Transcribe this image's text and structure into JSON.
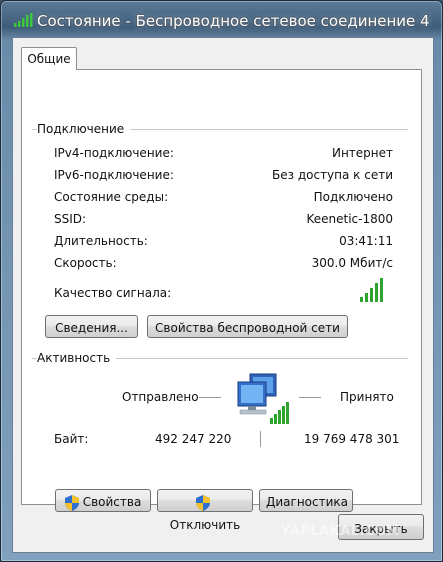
{
  "window": {
    "title": "Состояние - Беспроводное сетевое соединение 4"
  },
  "tabs": [
    {
      "label": "Общие"
    }
  ],
  "connection": {
    "section_title": "Подключение",
    "rows": [
      {
        "label": "IPv4-подключение:",
        "value": "Интернет"
      },
      {
        "label": "IPv6-подключение:",
        "value": "Без доступа к сети"
      },
      {
        "label": "Состояние среды:",
        "value": "Подключено"
      },
      {
        "label": "SSID:",
        "value": "Keenetic-1800"
      },
      {
        "label": "Длительность:",
        "value": "03:41:11"
      },
      {
        "label": "Скорость:",
        "value": "300.0 Мбит/с"
      }
    ],
    "signal_label": "Качество сигнала:",
    "signal_bars": 5
  },
  "buttons": {
    "details": "Сведения...",
    "wireless_props": "Свойства беспроводной сети",
    "properties": "Свойства",
    "disable": "Отключить",
    "diagnose": "Диагностика",
    "close": "Закрыть"
  },
  "activity": {
    "section_title": "Активность",
    "sent_label": "Отправлено",
    "received_label": "Принято",
    "bytes_label": "Байт:",
    "bytes_sent": "492 247 220",
    "bytes_received": "19 769 478 301"
  },
  "watermark": "YAPLAKAL.COM",
  "colors": {
    "signal": "#2ea42e",
    "titlebar": "#3e5c78",
    "client": "#f0f0f0"
  }
}
